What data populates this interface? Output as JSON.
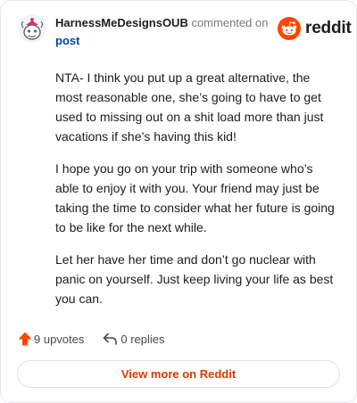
{
  "header": {
    "username": "HarnessMeDesignsOUB",
    "action_text": "commented on",
    "post_link": "post",
    "avatar_icon": "snoo-avatar-icon"
  },
  "brand": {
    "icon": "reddit-logo-icon",
    "wordmark": "reddit",
    "accent_color": "#ff4500"
  },
  "comment": {
    "paragraphs": [
      "NTA- I think you put up a great alternative, the most reasonable one, she’s going to have to get used to missing out on a shit load more than just vacations if she’s having this kid!",
      "I hope you go on your trip with someone who’s able to enjoy it with you. Your friend may just be taking the time to consider what her future is going to be like for the next while.",
      "Let her have her time and don’t go nuclear with panic on yourself. Just keep living your life as best you can."
    ]
  },
  "actions": {
    "upvotes_label": "9 upvotes",
    "upvote_icon": "upvote-arrow-icon",
    "upvote_color": "#ff4500",
    "replies_label": "0 replies",
    "reply_icon": "reply-arrow-icon"
  },
  "footer": {
    "view_more_label": "View more on Reddit",
    "link_color": "#d93a00"
  }
}
